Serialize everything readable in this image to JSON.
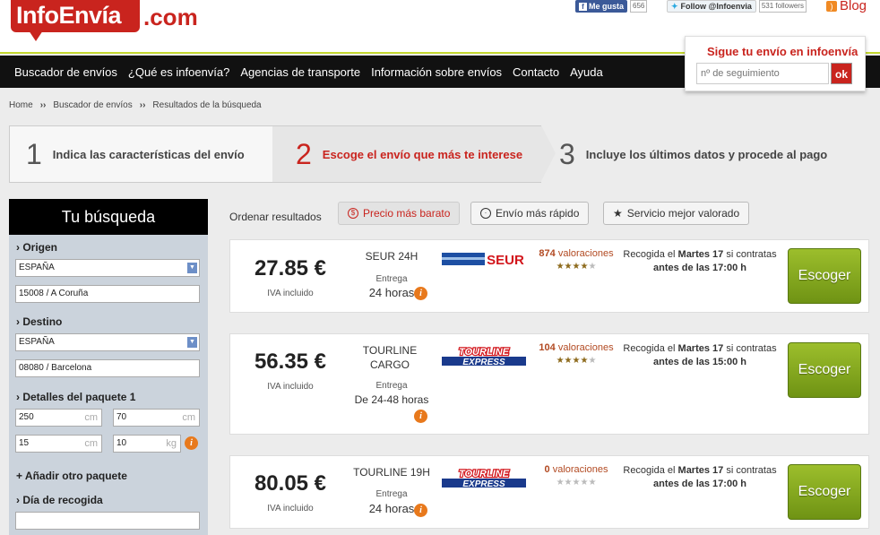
{
  "brand": {
    "logo": "InfoEnvía",
    "domain": ".com"
  },
  "social": {
    "fb_label": "Me gusta",
    "fb_count": "656",
    "tw_label": "Follow @Infoenvia",
    "tw_count": "531 followers",
    "blog_label": "Blog"
  },
  "nav": [
    "Buscador de envíos",
    "¿Qué es infoenvía?",
    "Agencias de transporte",
    "Información sobre envíos",
    "Contacto",
    "Ayuda"
  ],
  "tracking": {
    "title": "Sigue tu envío en infoenvía",
    "placeholder": "nº de seguimiento",
    "button": "ok"
  },
  "breadcrumb": {
    "home": "Home",
    "search": "Buscador de envíos",
    "current": "Resultados de la búsqueda",
    "sep": "››"
  },
  "steps": [
    {
      "num": "1",
      "text": "Indica las características del envío"
    },
    {
      "num": "2",
      "text": "Escoge el envío que más te interese"
    },
    {
      "num": "3",
      "text": "Incluye los últimos datos y procede al pago"
    }
  ],
  "sidebar": {
    "title": "Tu búsqueda",
    "origin_label": "Origen",
    "origin_country": "ESPAÑA",
    "origin_zip": "15008 / A Coruña",
    "dest_label": "Destino",
    "dest_country": "ESPAÑA",
    "dest_zip": "08080 / Barcelona",
    "package_label": "Detalles del paquete 1",
    "dim1": "250",
    "dim2": "70",
    "dim3": "15",
    "weight": "10",
    "unit_cm": "cm",
    "unit_kg": "kg",
    "add_package": "+ Añadir otro paquete",
    "pickup_label": "Día de recogida"
  },
  "sort": {
    "label": "Ordenar resultados",
    "cheapest": "Precio más barato",
    "fastest": "Envío más rápido",
    "best": "Servicio mejor valorado"
  },
  "results": [
    {
      "price": "27.85 €",
      "iva": "IVA incluido",
      "service": "SEUR 24H",
      "entrega": "Entrega",
      "time": "24 horas",
      "carrier": "SEUR",
      "reviews_count": "874",
      "reviews_word": "valoraciones",
      "rating": 4,
      "pickup_prefix": "Recogida el ",
      "pickup_day": "Martes 17",
      "pickup_suffix": " si contratas",
      "pickup_deadline": "antes de las 17:00 h",
      "button": "Escoger"
    },
    {
      "price": "56.35 €",
      "iva": "IVA incluido",
      "service": "TOURLINE CARGO",
      "entrega": "Entrega",
      "time": "De 24-48 horas",
      "carrier": "TOURLINE EXPRESS",
      "reviews_count": "104",
      "reviews_word": "valoraciones",
      "rating": 4,
      "pickup_prefix": "Recogida el ",
      "pickup_day": "Martes 17",
      "pickup_suffix": " si contratas",
      "pickup_deadline": "antes de las 15:00 h",
      "button": "Escoger"
    },
    {
      "price": "80.05 €",
      "iva": "IVA incluido",
      "service": "TOURLINE 19H",
      "entrega": "Entrega",
      "time": "24 horas",
      "carrier": "TOURLINE EXPRESS",
      "reviews_count": "0",
      "reviews_word": "valoraciones",
      "rating": 0,
      "pickup_prefix": "Recogida el ",
      "pickup_day": "Martes 17",
      "pickup_suffix": " si contratas",
      "pickup_deadline": "antes de las 17:00 h",
      "button": "Escoger"
    }
  ],
  "colors": {
    "brand_red": "#c9241e",
    "accent_green": "#c4d82e",
    "button_green": "#7fa51c"
  }
}
